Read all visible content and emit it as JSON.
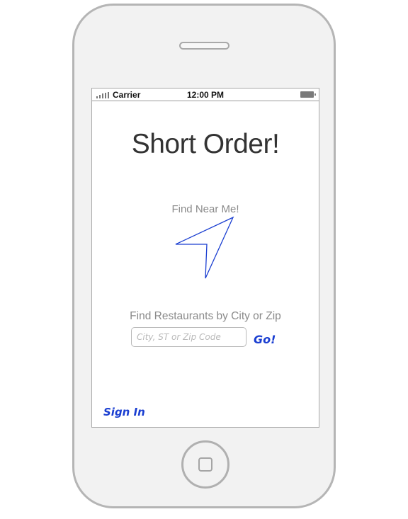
{
  "status_bar": {
    "carrier": "Carrier",
    "time": "12:00 PM"
  },
  "app": {
    "title": "Short Order!"
  },
  "locate": {
    "label": "Find Near Me!"
  },
  "search": {
    "label": "Find Restaurants by City or Zip",
    "placeholder": "City, ST or Zip Code",
    "go_label": "Go!"
  },
  "footer": {
    "sign_in_label": "Sign In"
  },
  "colors": {
    "accent": "#1a3ed1",
    "arrow_stroke": "#1a3ed1"
  }
}
